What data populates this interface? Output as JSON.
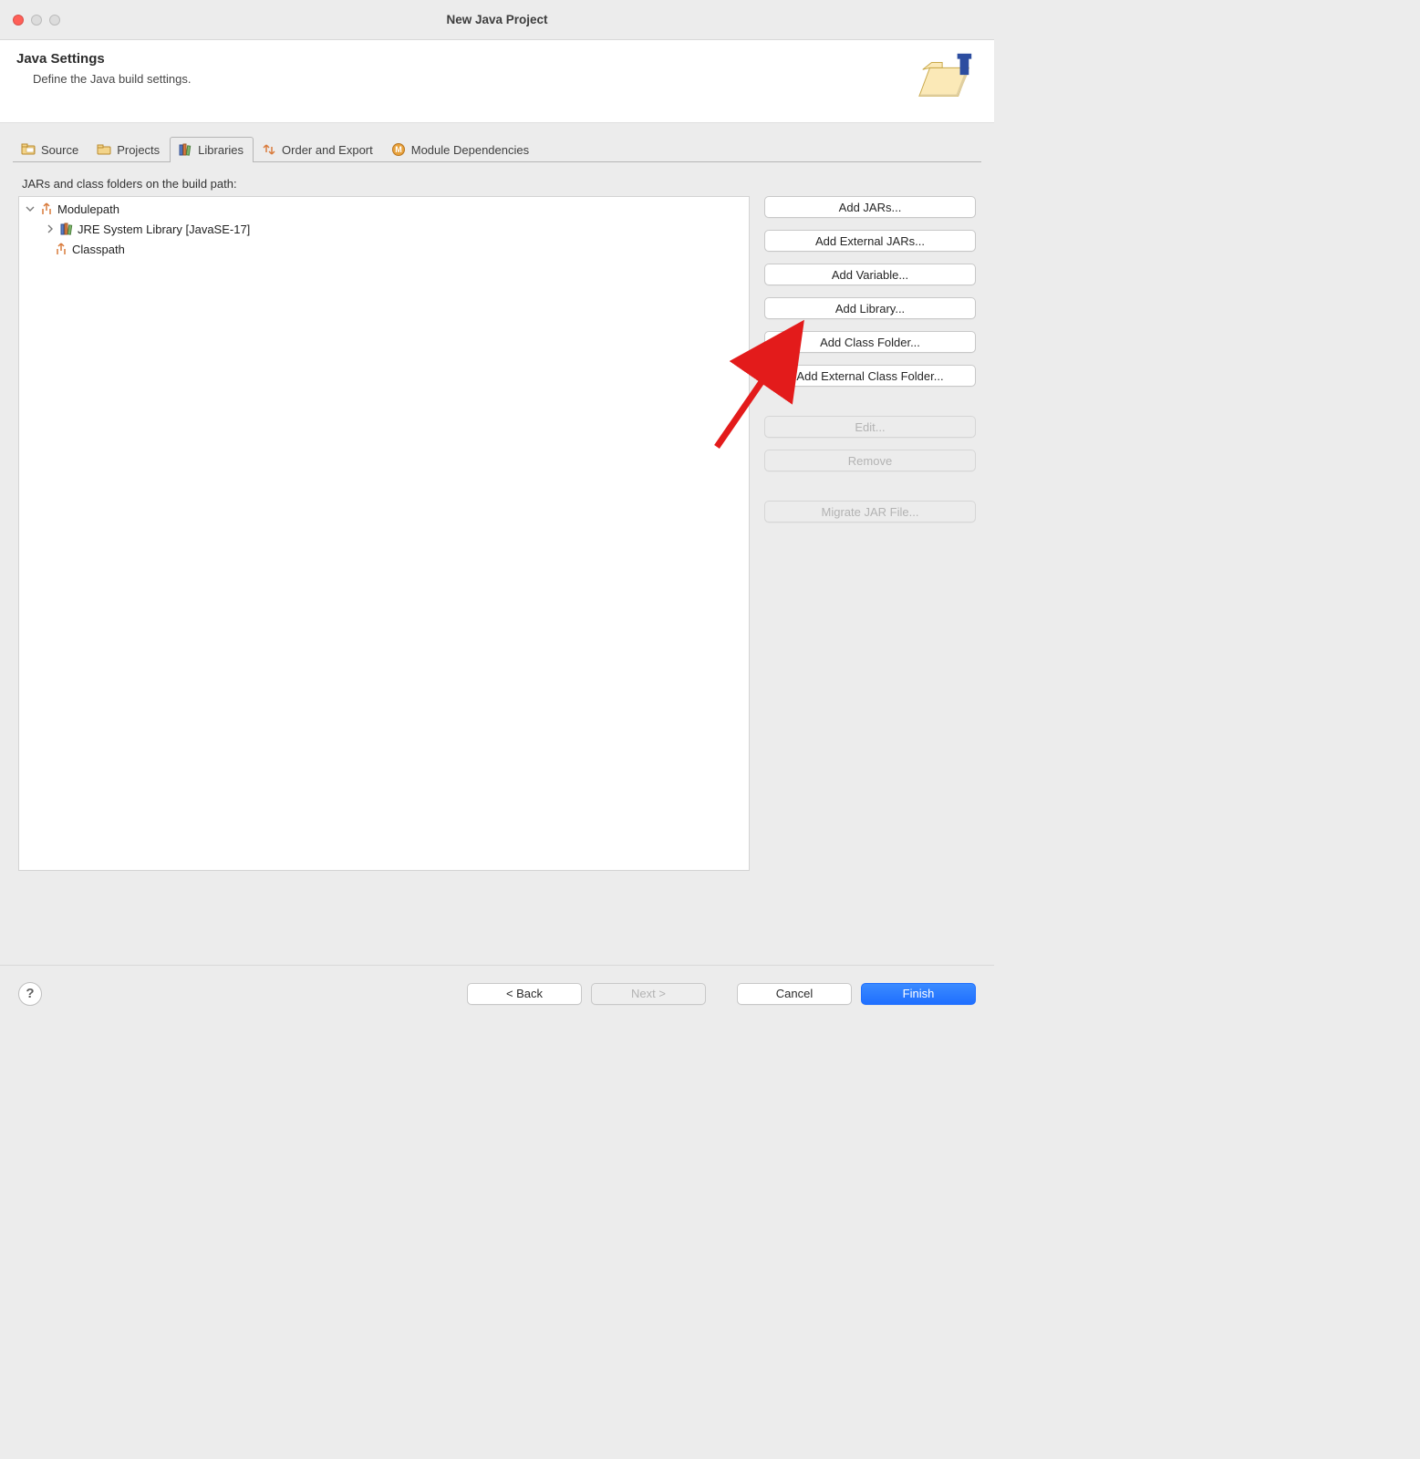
{
  "window": {
    "title": "New Java Project"
  },
  "header": {
    "title": "Java Settings",
    "subtitle": "Define the Java build settings."
  },
  "tabs": [
    {
      "label": "Source",
      "icon": "source-icon"
    },
    {
      "label": "Projects",
      "icon": "projects-icon"
    },
    {
      "label": "Libraries",
      "icon": "libraries-icon",
      "active": true
    },
    {
      "label": "Order and Export",
      "icon": "order-export-icon"
    },
    {
      "label": "Module Dependencies",
      "icon": "module-deps-icon"
    }
  ],
  "list_heading": "JARs and class folders on the build path:",
  "tree": {
    "modulepath_label": "Modulepath",
    "jre_label": "JRE System Library [JavaSE-17]",
    "classpath_label": "Classpath"
  },
  "side_buttons": [
    {
      "label": "Add JARs...",
      "enabled": true
    },
    {
      "label": "Add External JARs...",
      "enabled": true
    },
    {
      "label": "Add Variable...",
      "enabled": true
    },
    {
      "label": "Add Library...",
      "enabled": true
    },
    {
      "label": "Add Class Folder...",
      "enabled": true
    },
    {
      "label": "Add External Class Folder...",
      "enabled": true
    },
    {
      "label": "Edit...",
      "enabled": false
    },
    {
      "label": "Remove",
      "enabled": false
    },
    {
      "label": "Migrate JAR File...",
      "enabled": false
    }
  ],
  "footer": {
    "back": "< Back",
    "next": "Next >",
    "cancel": "Cancel",
    "finish": "Finish"
  },
  "annotation": {
    "target": "Add Library..."
  }
}
